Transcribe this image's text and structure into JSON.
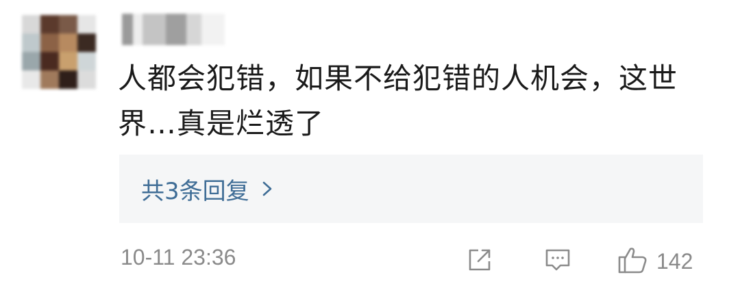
{
  "comment": {
    "text": "人都会犯错，如果不给犯错的人机会，这世界…真是烂透了",
    "replies_label": "共3条回复",
    "timestamp": "10-11 23:36",
    "like_count": "142"
  },
  "colors": {
    "link": "#3f6d96",
    "meta": "#8a8a8a",
    "reply_bg": "#f5f6f7"
  },
  "icons": {
    "share": "share-icon",
    "comment": "comment-icon",
    "like": "thumbs-up-icon",
    "chevron": "chevron-right-icon"
  }
}
